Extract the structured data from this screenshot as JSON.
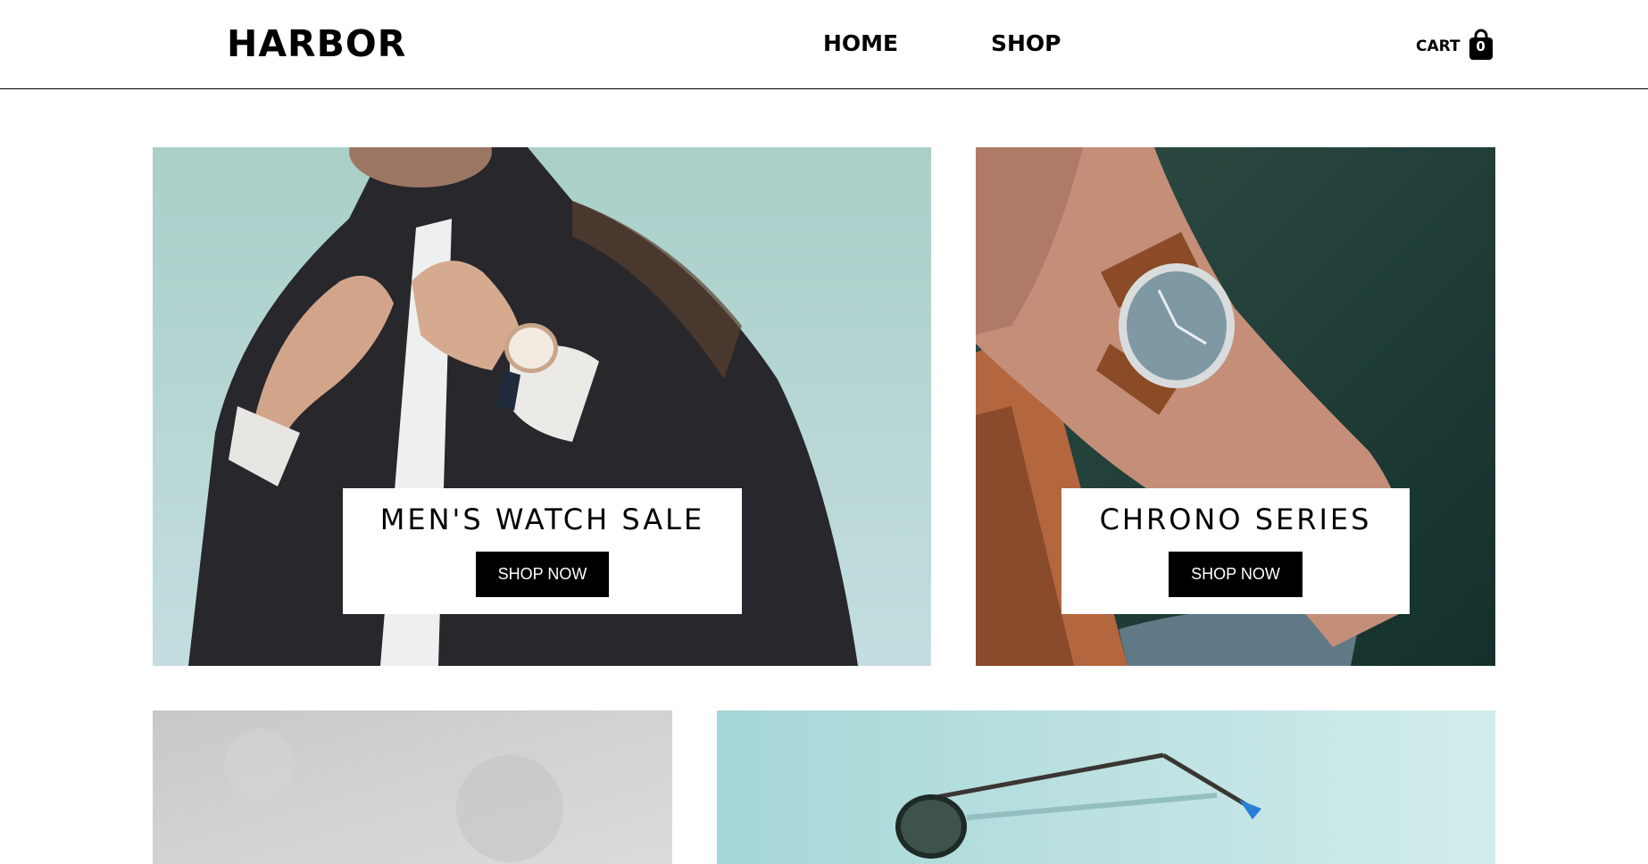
{
  "brand": {
    "name": "HARBOR"
  },
  "nav": {
    "items": [
      {
        "label": "HOME"
      },
      {
        "label": "SHOP"
      }
    ]
  },
  "cart": {
    "label": "CART",
    "count": "0",
    "icon": "shopping-bag-icon"
  },
  "tiles": [
    {
      "title": "MEN'S WATCH SALE",
      "button": "SHOP NOW"
    },
    {
      "title": "CHRONO SERIES",
      "button": "SHOP NOW"
    }
  ]
}
